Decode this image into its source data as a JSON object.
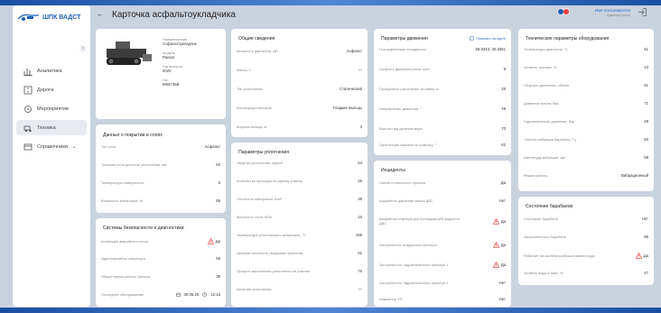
{
  "brand": {
    "name": "ШПК ВАДСТ"
  },
  "nav": {
    "collapse": "‹",
    "items": [
      {
        "label": "Аналитика",
        "icon": "analytics-icon"
      },
      {
        "label": "Дороги",
        "icon": "road-icon"
      },
      {
        "label": "Мероприятие",
        "icon": "event-icon"
      },
      {
        "label": "Техника",
        "icon": "machinery-icon"
      },
      {
        "label": "Справочники",
        "icon": "directory-icon",
        "chevron": "⌄"
      }
    ]
  },
  "header": {
    "back": "←",
    "title": "Карточка асфальтоукладчика"
  },
  "user": {
    "name": "Имя пользователя",
    "role": "Администратор"
  },
  "colors": {
    "accent": "#1f5eb3",
    "danger": "#e53935",
    "bg": "#c9d3de"
  },
  "machine": {
    "fields": [
      {
        "label": "Наименование",
        "value": "Асфальтоукладчик"
      },
      {
        "label": "Модель",
        "value": "Раскат"
      },
      {
        "label": "Год выпуска",
        "value": "2020"
      },
      {
        "label": "Гос.",
        "value": "МК6735В"
      }
    ]
  },
  "coating": {
    "title": "Данные о покрытии и слоях",
    "rows": [
      {
        "label": "Тип слоя",
        "value": "Асфальт"
      },
      {
        "label": "Толщина слоя до/после уплотнения, мм",
        "value": "62"
      },
      {
        "label": "Температура поверхности",
        "value": "5"
      },
      {
        "label": "Влажность материала, %",
        "value": "86"
      }
    ]
  },
  "safety": {
    "title": "Системы безопасности и диагностики",
    "rows": [
      {
        "label": "Активация аварийного стопа",
        "value": "Да",
        "warn": true
      },
      {
        "label": "Идентификатор оператора",
        "value": "56"
      },
      {
        "label": "Общее время работы техники",
        "value": "36"
      }
    ],
    "last": {
      "label": "Последнее обслуживание",
      "date": "30.05.25",
      "time": "12:15"
    }
  },
  "general": {
    "title": "Общие сведения",
    "rows": [
      {
        "label": "Мощность двигателя, кВт",
        "value": "Асфальт"
      },
      {
        "label": "Масса, т",
        "value": "—"
      },
      {
        "label": "Тип уплотнения",
        "value": "Статический"
      },
      {
        "label": "Конструкция вальцов",
        "value": "Гладкие вальцы"
      },
      {
        "label": "Ширина вальца, м",
        "value": "3"
      }
    ]
  },
  "compaction": {
    "title": "Параметры уплотнения",
    "rows": [
      {
        "label": "Энергия уплотнения, кДж/м²",
        "value": "64"
      },
      {
        "label": "Количество проходов по одному участку",
        "value": "25"
      },
      {
        "label": "Плотность материала, кг/м³",
        "value": "38"
      },
      {
        "label": "Жесткость слоя, МПа",
        "value": "16"
      },
      {
        "label": "Температура уплотняемого материала, °С",
        "value": "159"
      },
      {
        "label": "Целевая плотность (заданная проектом)",
        "value": "81"
      },
      {
        "label": "Процент выполнения уплотнения на участке",
        "value": "76"
      },
      {
        "label": "Качество уплотнения",
        "value": "—"
      }
    ]
  },
  "motion": {
    "title": "Параметры движения",
    "link": "Показать на карте",
    "rows": [
      {
        "label": "Географические координаты",
        "value": "59.9343, 30.3351"
      },
      {
        "label": "Скорость движения катка, км/ч",
        "value": "9"
      },
      {
        "label": "Пройденное расстояние за смену, м",
        "value": "28"
      },
      {
        "label": "Направление движения, °",
        "value": "49"
      },
      {
        "label": "Высота над уровнем моря",
        "value": "70"
      },
      {
        "label": "Ориентация машины по компасу, °",
        "value": "62"
      }
    ]
  },
  "incidents": {
    "title": "Инциденты",
    "rows": [
      {
        "label": "Смена стояночного тормоза",
        "value": "Да"
      },
      {
        "label": "Аварийное давление масла ДВС",
        "value": "Нет"
      },
      {
        "label": "Аварийная температура охлаждающей жидкости ДВС",
        "value": "Да",
        "warn": true
      },
      {
        "label": "Засоренность воздушного фильтра",
        "value": "Да",
        "warn": true
      },
      {
        "label": "Засоренность гидравлического фильтра 1",
        "value": "Да",
        "warn": true
      },
      {
        "label": "Засоренность гидравлического фильтра 2",
        "value": "Нет"
      },
      {
        "label": "Индикатор КП",
        "value": "Нет"
      }
    ]
  },
  "tech": {
    "title": "Технические параметры оборудования",
    "rows": [
      {
        "label": "Температура двигателя, °С",
        "value": "51"
      },
      {
        "label": "Уровень топлива, %",
        "value": "43"
      },
      {
        "label": "Обороты двигателя, об/мин",
        "value": "81"
      },
      {
        "label": "Давление масла, бар",
        "value": "71"
      },
      {
        "label": "Гидравлическое давление, бар",
        "value": "29"
      },
      {
        "label": "Частота вибрации барабана, Гц",
        "value": "50"
      },
      {
        "label": "Амплитуда вибрации, мм",
        "value": "58"
      },
      {
        "label": "Режим работы",
        "value": "Вибрационный"
      }
    ]
  },
  "drums": {
    "title": "Состояние барабанов",
    "rows": [
      {
        "label": "Состояние барабана",
        "value": "Нет"
      },
      {
        "label": "Загрязненность барабана",
        "value": "86"
      },
      {
        "label": "Работает ли система разбрызгивания воды",
        "value": "Да",
        "warn": true
      },
      {
        "label": "Уровень воды в баке, %",
        "value": "47"
      }
    ]
  }
}
